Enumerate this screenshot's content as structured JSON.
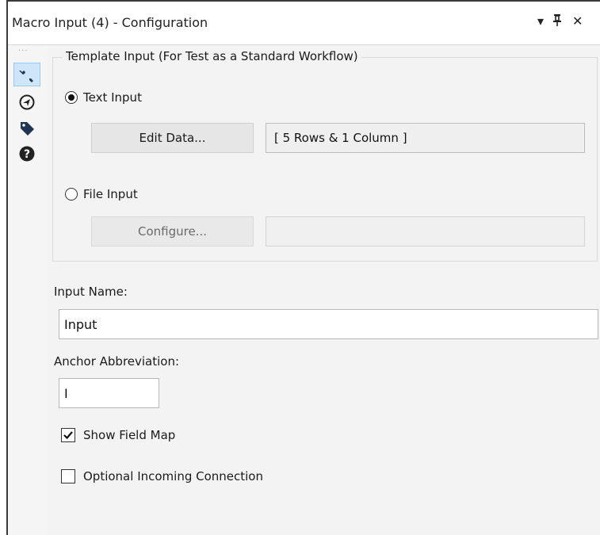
{
  "window": {
    "title": "Macro Input (4) - Configuration",
    "dropdown_glyph": "▾",
    "pin_glyph": "ᵽ",
    "close_glyph": "✕"
  },
  "sidebar": {
    "dots": "···",
    "items": [
      {
        "icon": "wrench-icon",
        "active": true
      },
      {
        "icon": "navigator-icon",
        "active": false
      },
      {
        "icon": "tag-icon",
        "active": false
      },
      {
        "icon": "help-icon",
        "active": false
      }
    ]
  },
  "template_group": {
    "legend": "Template Input (For Test as a Standard Workflow)",
    "text_input": {
      "label": "Text Input",
      "selected": true,
      "edit_button": "Edit Data...",
      "summary": "[ 5 Rows & 1 Column ]"
    },
    "file_input": {
      "label": "File Input",
      "selected": false,
      "configure_button": "Configure...",
      "path": ""
    }
  },
  "input_name": {
    "label": "Input Name:",
    "value": "Input"
  },
  "anchor": {
    "label": "Anchor Abbreviation:",
    "value": "I"
  },
  "options": {
    "show_field_map": {
      "label": "Show Field Map",
      "checked": true
    },
    "optional_incoming": {
      "label": "Optional Incoming Connection",
      "checked": false
    }
  },
  "colors": {
    "active_icon_bg": "#cfe6fa",
    "content_bg": "#f3f3f3"
  }
}
